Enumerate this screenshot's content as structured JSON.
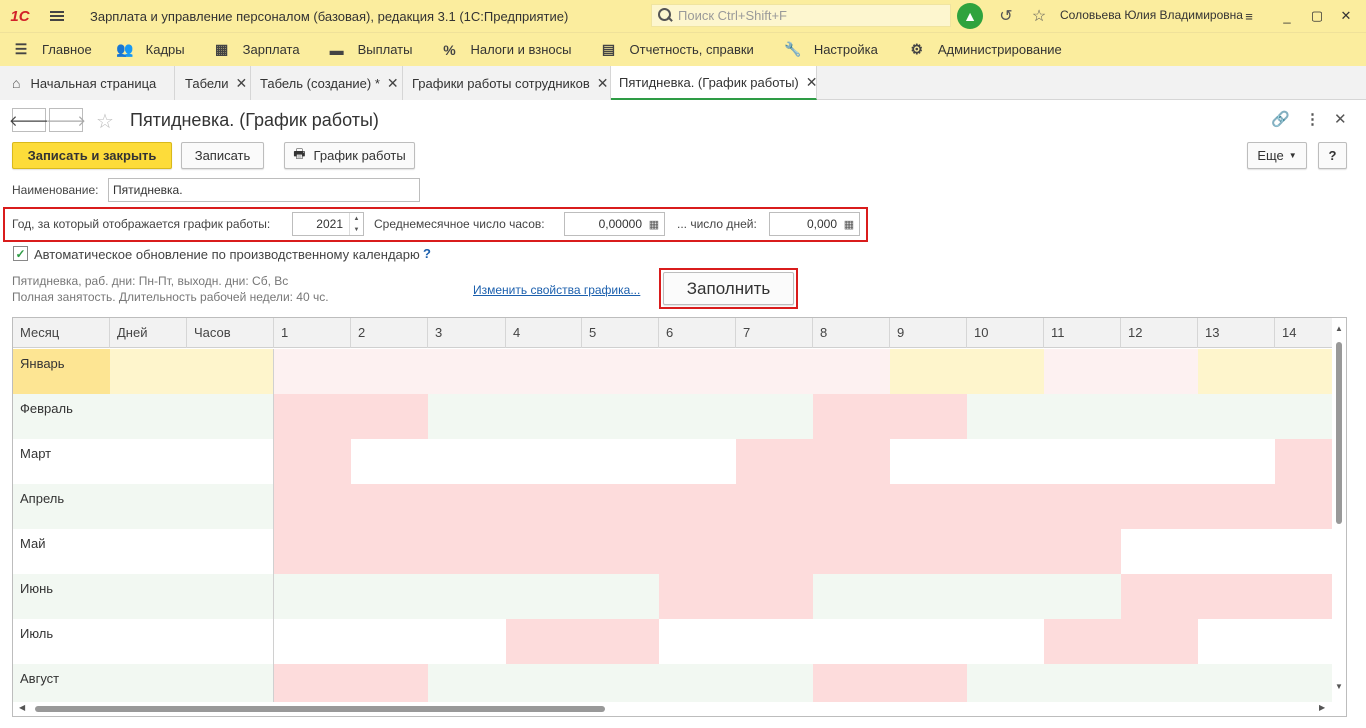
{
  "titlebar": {
    "logo": "1С",
    "app_title": "Зарплата и управление персоналом (базовая), редакция 3.1  (1С:Предприятие)",
    "search_placeholder": "Поиск Ctrl+Shift+F",
    "user": "Соловьева Юлия Владимировна"
  },
  "sections": [
    {
      "label": "Главное",
      "icon": "hamburger-icon"
    },
    {
      "label": "Кадры",
      "icon": "people-icon"
    },
    {
      "label": "Зарплата",
      "icon": "calculator-icon"
    },
    {
      "label": "Выплаты",
      "icon": "wallet-icon"
    },
    {
      "label": "Налоги и взносы",
      "icon": "percent-icon"
    },
    {
      "label": "Отчетность, справки",
      "icon": "documents-icon"
    },
    {
      "label": "Настройка",
      "icon": "wrench-icon"
    },
    {
      "label": "Администрирование",
      "icon": "gear-icon"
    }
  ],
  "tabs": [
    {
      "label": "Начальная страница",
      "closable": false
    },
    {
      "label": "Табели",
      "closable": true
    },
    {
      "label": "Табель (создание) *",
      "closable": true
    },
    {
      "label": "Графики работы сотрудников",
      "closable": true
    },
    {
      "label": "Пятидневка. (График работы)",
      "closable": true,
      "active": true
    }
  ],
  "form": {
    "title": "Пятидневка. (График работы)",
    "save_close": "Записать и закрыть",
    "save": "Записать",
    "schedule": "График работы",
    "more": "Еще",
    "help": "?",
    "name_label": "Наименование:",
    "name_value": "Пятидневка.",
    "year_label": "Год, за который отображается график работы:",
    "year_value": "2021",
    "avg_hours_label": "Среднемесячное число часов:",
    "avg_hours_value": "0,00000",
    "days_label": "... число дней:",
    "days_value": "0,000",
    "auto_update_label": "Автоматическое обновление по производственному календарю",
    "auto_update_checked": true,
    "info_line1": "Пятидневка, раб. дни: Пн-Пт, выходн. дни: Сб, Вс",
    "info_line2": "Полная занятость. Длительность рабочей недели: 40 чс.",
    "change_link": "Изменить свойства графика...",
    "fill_button": "Заполнить"
  },
  "table": {
    "headers": [
      "Месяц",
      "Дней",
      "Часов",
      "1",
      "2",
      "3",
      "4",
      "5",
      "6",
      "7",
      "8",
      "9",
      "10",
      "11",
      "12",
      "13",
      "14"
    ],
    "months": [
      "Январь",
      "Февраль",
      "Март",
      "Апрель",
      "Май",
      "Июнь",
      "Июль",
      "Август"
    ],
    "colors": {
      "holiday": "#fddcdc",
      "weekend_pink": "#fdf1f1",
      "selected_row": "#fef5cc",
      "selected_cell": "#fde593",
      "workday_even": "#f2f8f2",
      "workday_odd": "#ffffff",
      "jan_workday": "#fef5cc"
    },
    "day_types": [
      [
        "p",
        "p",
        "p",
        "p",
        "p",
        "p",
        "p",
        "p",
        "y",
        "y",
        "p",
        "p",
        "y",
        "y"
      ],
      [
        "h",
        "h",
        "w",
        "w",
        "w",
        "w",
        "w",
        "h",
        "h",
        "w",
        "w",
        "w",
        "w",
        "w"
      ],
      [
        "h",
        "w",
        "w",
        "w",
        "w",
        "w",
        "h",
        "h",
        "w",
        "w",
        "w",
        "w",
        "w",
        "h"
      ],
      [
        "h",
        "h",
        "h",
        "h",
        "h",
        "h",
        "h",
        "h",
        "h",
        "h",
        "h",
        "h",
        "h",
        "h"
      ],
      [
        "h",
        "h",
        "h",
        "h",
        "h",
        "h",
        "h",
        "h",
        "h",
        "h",
        "h",
        "w",
        "w",
        "w"
      ],
      [
        "w",
        "w",
        "w",
        "w",
        "w",
        "h",
        "h",
        "w",
        "w",
        "w",
        "w",
        "h",
        "h",
        "h"
      ],
      [
        "w",
        "w",
        "w",
        "h",
        "h",
        "w",
        "w",
        "w",
        "w",
        "w",
        "h",
        "h",
        "w",
        "w"
      ],
      [
        "h",
        "h",
        "w",
        "w",
        "w",
        "w",
        "w",
        "h",
        "h",
        "w",
        "w",
        "w",
        "w",
        "w"
      ]
    ]
  }
}
